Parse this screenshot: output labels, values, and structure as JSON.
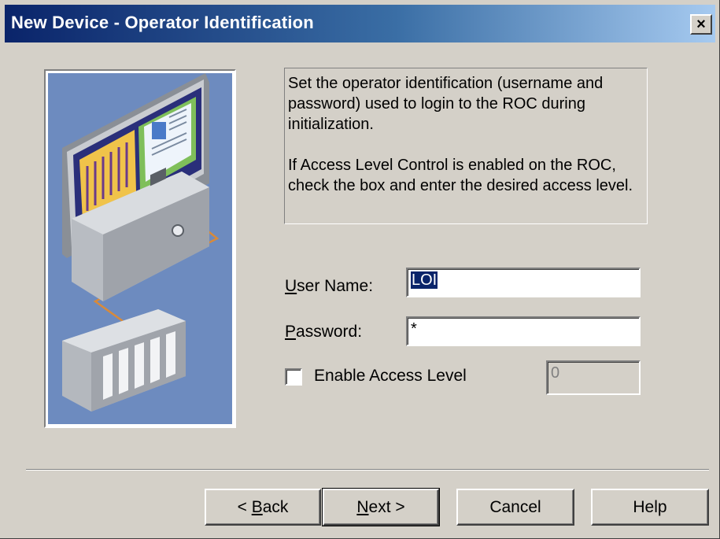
{
  "window": {
    "title": "New Device - Operator Identification",
    "close_glyph": "×"
  },
  "illustration": {
    "icon": "computer-network-device-icon"
  },
  "description": {
    "paragraph1": "Set the operator identification (username and password) used to login to the ROC during initialization.",
    "paragraph2": "If Access Level Control is enabled on the ROC, check the box and enter the desired access level."
  },
  "form": {
    "user_name_label_mnemonic": "U",
    "user_name_label_rest": "ser Name:",
    "user_name_value": "LOI",
    "password_label_mnemonic": "P",
    "password_label_rest": "assword:",
    "password_value": "*",
    "enable_access_label": "Enable Access Level",
    "enable_access_checked": false,
    "access_level_value": "0"
  },
  "buttons": {
    "back_prefix": "< ",
    "back_mnemonic": "B",
    "back_rest": "ack",
    "next_mnemonic": "N",
    "next_rest": "ext >",
    "cancel": "Cancel",
    "help": "Help"
  }
}
